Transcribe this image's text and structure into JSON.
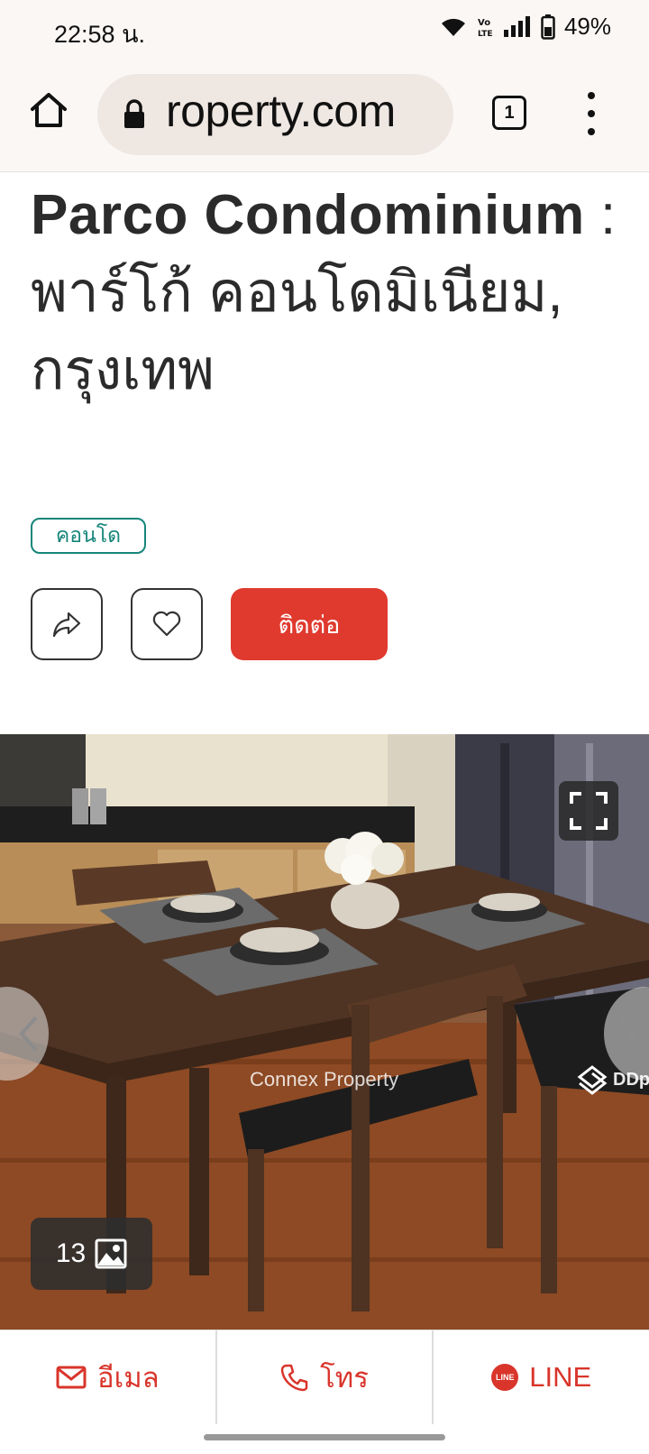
{
  "status_bar": {
    "time": "22:58 น.",
    "battery": "49%",
    "icons": [
      "wifi-icon",
      "volte-icon",
      "signal-icon",
      "battery-icon"
    ]
  },
  "browser": {
    "url": "roperty.com",
    "tab_count": "1"
  },
  "listing": {
    "title_en": "Parco Condominium",
    "title_separator": " : ",
    "title_th": "พาร์โก้ คอนโดมิเนียม, กรุงเทพ",
    "tag": "คอนโด",
    "contact_label": "ติดต่อ"
  },
  "gallery": {
    "watermark": "Connex Property",
    "brand_mark": "DDp",
    "photo_count": "13"
  },
  "bottom_bar": {
    "email_label": "อีเมล",
    "call_label": "โทร",
    "line_label": "LINE",
    "line_badge": "LINE"
  },
  "colors": {
    "accent_red": "#e03a2f",
    "tag_teal": "#16857a",
    "chrome_bg": "#fbf7f5"
  }
}
